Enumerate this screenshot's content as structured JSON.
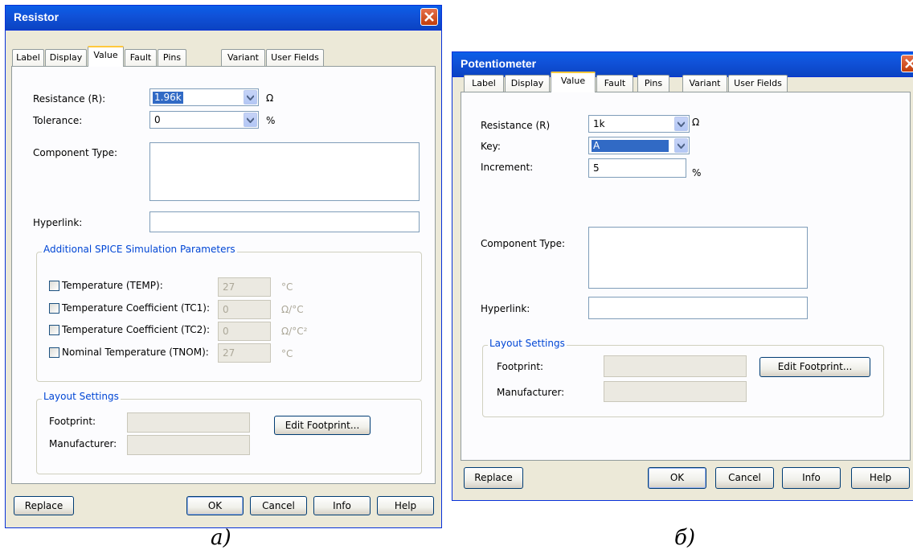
{
  "resistor": {
    "title": "Resistor",
    "tabs": [
      "Label",
      "Display",
      "Value",
      "Fault",
      "Pins",
      "Variant",
      "User Fields"
    ],
    "active_tab": "Value",
    "resistance_label": "Resistance (R):",
    "resistance_value": "1.96k",
    "resistance_unit": "Ω",
    "tolerance_label": "Tolerance:",
    "tolerance_value": "0",
    "tolerance_unit": "%",
    "component_type_label": "Component Type:",
    "hyperlink_label": "Hyperlink:",
    "spice_group_title": "Additional SPICE Simulation Parameters",
    "spice_params": [
      {
        "label": "Temperature (TEMP):",
        "value": "27",
        "unit": "°C"
      },
      {
        "label": "Temperature Coefficient (TC1):",
        "value": "0",
        "unit": "Ω/°C"
      },
      {
        "label": "Temperature Coefficient (TC2):",
        "value": "0",
        "unit": "Ω/°C²"
      },
      {
        "label": "Nominal Temperature (TNOM):",
        "value": "27",
        "unit": "°C"
      }
    ],
    "layout_group_title": "Layout Settings",
    "footprint_label": "Footprint:",
    "manufacturer_label": "Manufacturer:",
    "edit_footprint_button": "Edit Footprint...",
    "buttons": {
      "replace": "Replace",
      "ok": "OK",
      "cancel": "Cancel",
      "info": "Info",
      "help": "Help"
    }
  },
  "potentiometer": {
    "title": "Potentiometer",
    "tabs": [
      "Label",
      "Display",
      "Value",
      "Fault",
      "Pins",
      "Variant",
      "User Fields"
    ],
    "active_tab": "Value",
    "resistance_label": "Resistance (R)",
    "resistance_value": "1k",
    "resistance_unit": "Ω",
    "key_label": "Key:",
    "key_value": "A",
    "increment_label": "Increment:",
    "increment_value": "5",
    "increment_unit": "%",
    "component_type_label": "Component Type:",
    "hyperlink_label": "Hyperlink:",
    "layout_group_title": "Layout Settings",
    "footprint_label": "Footprint:",
    "manufacturer_label": "Manufacturer:",
    "edit_footprint_button": "Edit Footprint...",
    "buttons": {
      "replace": "Replace",
      "ok": "OK",
      "cancel": "Cancel",
      "info": "Info",
      "help": "Help"
    }
  },
  "captions": {
    "left": "а)",
    "right": "б)"
  },
  "colors": {
    "titlebar": "#0a5fe8",
    "window_bg": "#ece9d8",
    "group_title": "#0046d5",
    "selection": "#316ac5",
    "close_button": "#c23d0a"
  },
  "icons": [
    "close-icon",
    "dropdown-arrow-icon",
    "checkbox-icon"
  ]
}
